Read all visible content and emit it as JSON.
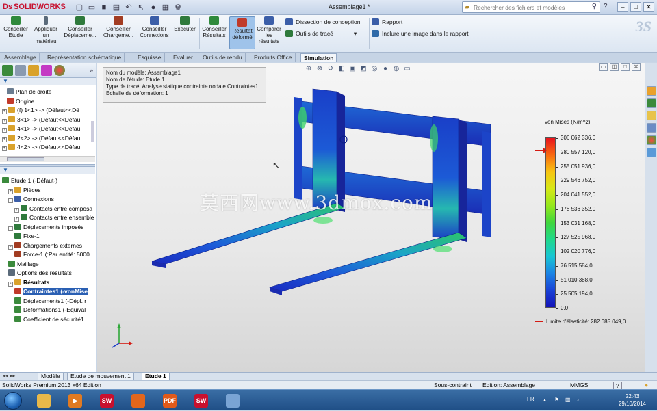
{
  "app": {
    "brand": "SOLIDWORKS",
    "document_title": "Assemblage1 *",
    "search_placeholder": "Rechercher des fichiers et modèles"
  },
  "ribbon": {
    "buttons": [
      {
        "label": "Conseiller Etude",
        "icon": "advisor-icon",
        "color": "#2f8a3c"
      },
      {
        "label": "Appliquer un matériau",
        "icon": "material-icon",
        "color": "#5a6a7a"
      },
      {
        "label": "Conseiller Déplaceme...",
        "icon": "fixture-icon",
        "color": "#2f7a3c"
      },
      {
        "label": "Conseiller Chargeme...",
        "icon": "load-icon",
        "color": "#a23c22"
      },
      {
        "label": "Conseiller Connexions",
        "icon": "connection-icon",
        "color": "#3b5ea8"
      },
      {
        "label": "Exécuter",
        "icon": "run-icon",
        "color": "#2f7a3c"
      },
      {
        "label": "Conseiller Résultats",
        "icon": "results-icon",
        "color": "#2f8a3c"
      },
      {
        "label": "Résultat déformé",
        "icon": "deformed-icon",
        "color": "#c03a2a"
      },
      {
        "label": "Comparer les résultats",
        "icon": "compare-icon",
        "color": "#3b5ea8"
      }
    ],
    "small": [
      {
        "label": "Dissection de conception",
        "icon": "dissection-icon"
      },
      {
        "label": "Outils de tracé",
        "icon": "plot-tools-icon"
      },
      {
        "label": "Rapport",
        "icon": "report-icon"
      },
      {
        "label": "Inclure une image dans le rapport",
        "icon": "image-report-icon"
      }
    ]
  },
  "tabs": [
    "Assemblage",
    "Représentation schématique",
    "Esquisse",
    "Evaluer",
    "Outils de rendu",
    "Produits Office",
    "Simulation"
  ],
  "feature_tree": [
    {
      "label": "Plan de droite",
      "expand": "",
      "icon": "#6a7c90"
    },
    {
      "label": "Origine",
      "expand": "",
      "icon": "#c23a2a"
    },
    {
      "label": "(f) 1<1> -> (Défaut<<Dé",
      "expand": "+",
      "icon": "#d9a22c"
    },
    {
      "label": "3<1> -> (Défaut<<Défau",
      "expand": "+",
      "icon": "#d9a22c"
    },
    {
      "label": "4<1> -> (Défaut<<Défau",
      "expand": "+",
      "icon": "#d9a22c"
    },
    {
      "label": "2<2> -> (Défaut<<Défau",
      "expand": "+",
      "icon": "#d9a22c"
    },
    {
      "label": "4<2> -> (Défaut<<Défau",
      "expand": "+",
      "icon": "#d9a22c"
    }
  ],
  "study_tree": [
    {
      "label": "Etude 1 (-Défaut-)",
      "indent": 0,
      "expand": "",
      "icon": "#3b8a3c",
      "bold": false,
      "sel": false
    },
    {
      "label": "Pièces",
      "indent": 1,
      "expand": "+",
      "icon": "#d9a22c",
      "bold": false,
      "sel": false
    },
    {
      "label": "Connexions",
      "indent": 1,
      "expand": "-",
      "icon": "#3b5ea8",
      "bold": false,
      "sel": false
    },
    {
      "label": "Contacts entre composa",
      "indent": 2,
      "expand": "+",
      "icon": "#2f7a3c",
      "bold": false,
      "sel": false
    },
    {
      "label": "Contacts entre ensemble",
      "indent": 2,
      "expand": "+",
      "icon": "#2f7a3c",
      "bold": false,
      "sel": false
    },
    {
      "label": "Déplacements imposés",
      "indent": 1,
      "expand": "-",
      "icon": "#2f7a3c",
      "bold": false,
      "sel": false
    },
    {
      "label": "Fixe-1",
      "indent": 2,
      "expand": "",
      "icon": "#2f7a3c",
      "bold": false,
      "sel": false
    },
    {
      "label": "Chargements externes",
      "indent": 1,
      "expand": "-",
      "icon": "#a23c22",
      "bold": false,
      "sel": false
    },
    {
      "label": "Force-1 (:Par entité: 5000",
      "indent": 2,
      "expand": "",
      "icon": "#a23c22",
      "bold": false,
      "sel": false
    },
    {
      "label": "Maillage",
      "indent": 1,
      "expand": "",
      "icon": "#3b8a3c",
      "bold": false,
      "sel": false
    },
    {
      "label": "Options des résultats",
      "indent": 1,
      "expand": "",
      "icon": "#5a6a7a",
      "bold": false,
      "sel": false
    },
    {
      "label": "Résultats",
      "indent": 1,
      "expand": "-",
      "icon": "#d9a22c",
      "bold": true,
      "sel": false
    },
    {
      "label": "Contraintes1 (-vonMise",
      "indent": 2,
      "expand": "",
      "icon": "#c03a2a",
      "bold": true,
      "sel": true
    },
    {
      "label": "Déplacements1 (-Dépl. r",
      "indent": 2,
      "expand": "",
      "icon": "#3b8a3c",
      "bold": false,
      "sel": false
    },
    {
      "label": "Déformations1 (-Equival",
      "indent": 2,
      "expand": "",
      "icon": "#3b8a3c",
      "bold": false,
      "sel": false
    },
    {
      "label": "Coefficient de sécurité1",
      "indent": 2,
      "expand": "",
      "icon": "#3b8a3c",
      "bold": false,
      "sel": false
    }
  ],
  "info": {
    "model": "Nom du modèle: Assemblage1",
    "study": "Nom de l'étude: Etude 1",
    "plot": "Type de tracé: Analyse statique contrainte nodale Contraintes1",
    "scale": "Echelle de déformation: 1"
  },
  "legend": {
    "title": "von Mises (N/m^2)",
    "ticks": [
      "306 062 336,0",
      "280 557 120,0",
      "255 051 936,0",
      "229 546 752,0",
      "204 041 552,0",
      "178 536 352,0",
      "153 031 168,0",
      "127 525 968,0",
      "102 020 776,0",
      "76 515 584,0",
      "51 010 388,0",
      "25 505 194,0",
      "0.0"
    ],
    "yield_label": "Limite d'élasticité: 282 685 049,0"
  },
  "watermark": "莫西网www.3dmox.com",
  "bottom_tabs": [
    "Modèle",
    "Etude de mouvement 1",
    "Etude 1"
  ],
  "status": {
    "edition": "SolidWorks Premium 2013 x64 Edition",
    "constraint": "Sous-contraint",
    "editing": "Edition: Assemblage",
    "units": "MMGS",
    "help": "?"
  },
  "taskbar": {
    "lang": "FR",
    "time": "22:43",
    "date": "29/10/2014",
    "apps": [
      {
        "name": "explorer-icon",
        "color": "#e8b84a",
        "text": ""
      },
      {
        "name": "media-player-icon",
        "color": "#e07a22",
        "text": "▶"
      },
      {
        "name": "solidworks-app-icon",
        "color": "#c8102e",
        "text": "SW"
      },
      {
        "name": "firefox-icon",
        "color": "#e2661b",
        "text": ""
      },
      {
        "name": "pdf-icon",
        "color": "#e05a1a",
        "text": "PDF"
      },
      {
        "name": "solidworks-app-icon-2",
        "color": "#c8102e",
        "text": "SW"
      },
      {
        "name": "window-icon",
        "color": "#7aa4d4",
        "text": ""
      }
    ]
  },
  "colors": {
    "accent": "#2a5fb3",
    "stress_max": "#e8141c",
    "stress_min": "#1414b8",
    "ribbon_active": "#9fc3ea"
  }
}
